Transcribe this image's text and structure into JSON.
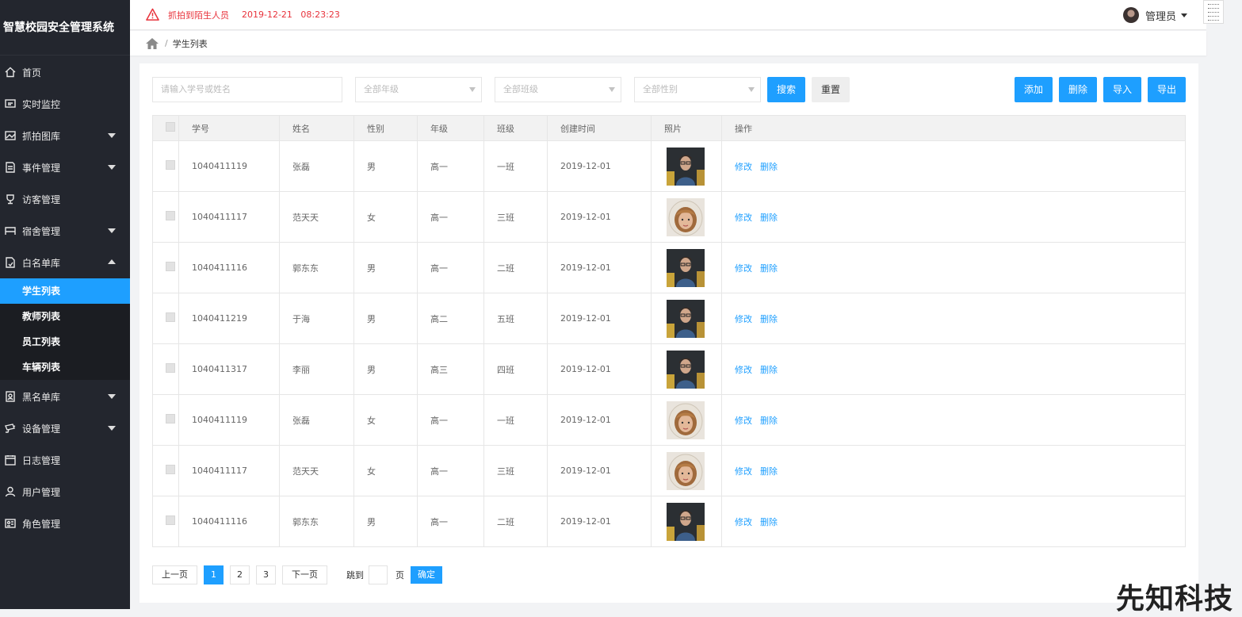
{
  "app": {
    "title": "智慧校园安全管理系统"
  },
  "header": {
    "alert_text": "抓拍到陌生人员",
    "alert_time": "2019-12-21   08:23:23",
    "user_name": "管理员"
  },
  "breadcrumb": {
    "current": "学生列表"
  },
  "sidebar": {
    "items": [
      {
        "label": "首页",
        "icon": "home-icon"
      },
      {
        "label": "实时监控",
        "icon": "monitor-icon"
      },
      {
        "label": "抓拍图库",
        "icon": "image-icon"
      },
      {
        "label": "事件管理",
        "icon": "document-icon"
      },
      {
        "label": "访客管理",
        "icon": "trophy-icon"
      },
      {
        "label": "宿舍管理",
        "icon": "bed-icon"
      },
      {
        "label": "白名单库",
        "icon": "file-icon"
      },
      {
        "label": "黑名单库",
        "icon": "contact-icon"
      },
      {
        "label": "设备管理",
        "icon": "camera-icon"
      },
      {
        "label": "日志管理",
        "icon": "calendar-icon"
      },
      {
        "label": "用户管理",
        "icon": "user-icon"
      },
      {
        "label": "角色管理",
        "icon": "id-card-icon"
      }
    ],
    "submenu": [
      "学生列表",
      "教师列表",
      "员工列表",
      "车辆列表"
    ]
  },
  "filters": {
    "search_placeholder": "请输入学号或姓名",
    "grade": "全部年级",
    "class": "全部班级",
    "gender": "全部性别",
    "search_btn": "搜索",
    "reset_btn": "重置"
  },
  "actions": {
    "add": "添加",
    "delete": "删除",
    "import": "导入",
    "export": "导出"
  },
  "table": {
    "headers": [
      "学号",
      "姓名",
      "性别",
      "年级",
      "班级",
      "创建时间",
      "照片",
      "操作"
    ],
    "rows": [
      {
        "id": "1040411119",
        "name": "张磊",
        "gender": "男",
        "grade": "高一",
        "class": "一班",
        "created": "2019-12-01",
        "photo": "male"
      },
      {
        "id": "1040411117",
        "name": "范天天",
        "gender": "女",
        "grade": "高一",
        "class": "三班",
        "created": "2019-12-01",
        "photo": "female"
      },
      {
        "id": "1040411116",
        "name": "郭东东",
        "gender": "男",
        "grade": "高一",
        "class": "二班",
        "created": "2019-12-01",
        "photo": "male"
      },
      {
        "id": "1040411219",
        "name": "于海",
        "gender": "男",
        "grade": "高二",
        "class": "五班",
        "created": "2019-12-01",
        "photo": "male"
      },
      {
        "id": "1040411317",
        "name": "李丽",
        "gender": "男",
        "grade": "高三",
        "class": "四班",
        "created": "2019-12-01",
        "photo": "male"
      },
      {
        "id": "1040411119",
        "name": "张磊",
        "gender": "女",
        "grade": "高一",
        "class": "一班",
        "created": "2019-12-01",
        "photo": "female"
      },
      {
        "id": "1040411117",
        "name": "范天天",
        "gender": "女",
        "grade": "高一",
        "class": "三班",
        "created": "2019-12-01",
        "photo": "female"
      },
      {
        "id": "1040411116",
        "name": "郭东东",
        "gender": "男",
        "grade": "高一",
        "class": "二班",
        "created": "2019-12-01",
        "photo": "male"
      }
    ],
    "edit_label": "修改",
    "delete_label": "删除"
  },
  "pager": {
    "prev": "上一页",
    "pages": [
      "1",
      "2",
      "3"
    ],
    "current": "1",
    "next": "下一页",
    "jump_label": "跳到",
    "page_unit": "页",
    "confirm": "确定"
  },
  "watermark": "先知科技",
  "colors": {
    "primary": "#1e9fff",
    "sidebar": "#23262e",
    "alert": "#e8323b"
  }
}
